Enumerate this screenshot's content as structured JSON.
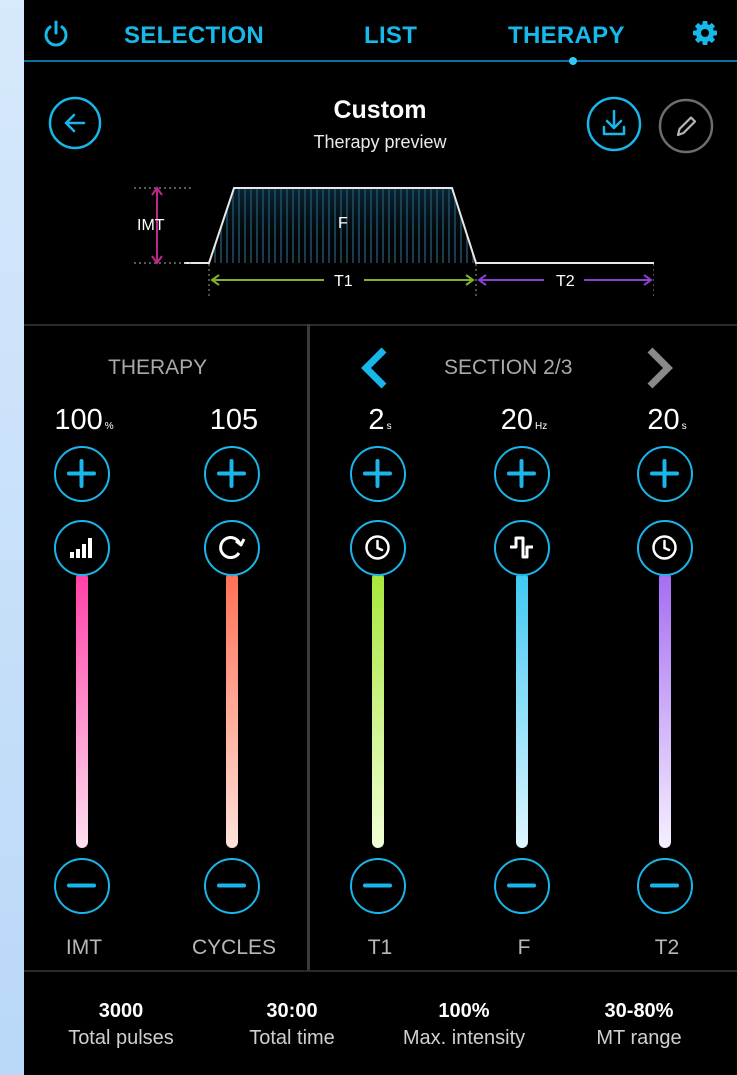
{
  "nav": {
    "tabs": [
      {
        "label": "SELECTION",
        "active": false
      },
      {
        "label": "LIST",
        "active": false
      },
      {
        "label": "THERAPY",
        "active": true
      }
    ],
    "power_icon": "power-icon",
    "settings_icon": "gear-icon"
  },
  "header": {
    "title": "Custom",
    "subtitle": "Therapy preview",
    "back_icon": "arrow-left-icon",
    "download_icon": "download-icon",
    "edit_icon": "pencil-icon"
  },
  "preview": {
    "imt_label": "IMT",
    "f_label": "F",
    "t1_label": "T1",
    "t2_label": "T2"
  },
  "therapy": {
    "heading": "THERAPY",
    "controls": [
      {
        "key": "imt",
        "value": "100",
        "unit": "%",
        "label": "IMT",
        "icon": "signal-bars-icon",
        "color_top": "#ff3fa6",
        "color_bottom": "#ffe0f0"
      },
      {
        "key": "cycles",
        "value": "105",
        "unit": "",
        "label": "CYCLES",
        "icon": "cycle-icon",
        "color_top": "#ff6f53",
        "color_bottom": "#ffe3dc"
      }
    ]
  },
  "section": {
    "heading": "SECTION 2/3",
    "controls": [
      {
        "key": "t1",
        "value": "2",
        "unit": "s",
        "label": "T1",
        "icon": "clock-icon",
        "color_top": "#a8e63a",
        "color_bottom": "#f2ffd8"
      },
      {
        "key": "f",
        "value": "20",
        "unit": "Hz",
        "label": "F",
        "icon": "pulse-wave-icon",
        "color_top": "#3fc8f2",
        "color_bottom": "#dff6ff"
      },
      {
        "key": "t2",
        "value": "20",
        "unit": "s",
        "label": "T2",
        "icon": "clock-icon",
        "color_top": "#a56cf2",
        "color_bottom": "#f6f0ff"
      }
    ]
  },
  "stats": [
    {
      "value": "3000",
      "caption": "Total pulses"
    },
    {
      "value": "30:00",
      "caption": "Total time"
    },
    {
      "value": "100%",
      "caption": "Max. intensity"
    },
    {
      "value": "30-80%",
      "caption": "MT range"
    }
  ],
  "colors": {
    "accent": "#18b6ea",
    "background": "#000000"
  }
}
